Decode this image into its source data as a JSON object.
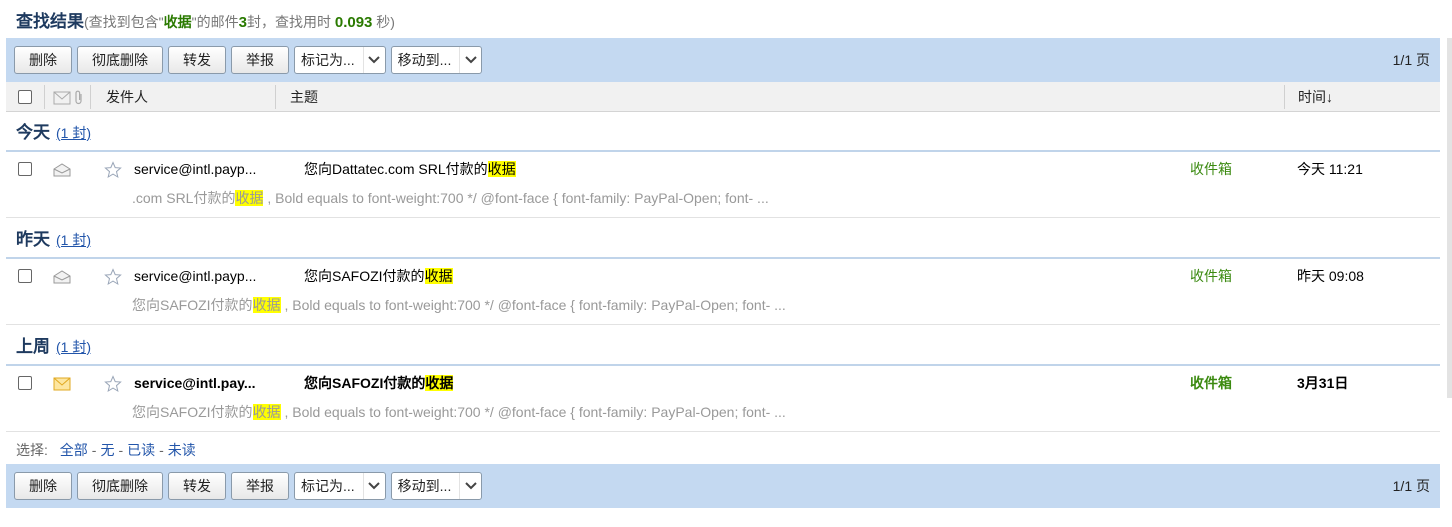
{
  "title": {
    "main": "查找结果",
    "sub_prefix": "(查找到包含\"",
    "keyword": "收据",
    "sub_mid": "\"的邮件",
    "count": "3",
    "sub_mid2": "封，查找用时 ",
    "time": "0.093",
    "sub_suffix": " 秒)"
  },
  "toolbar": {
    "delete": "删除",
    "delete_forever": "彻底删除",
    "forward": "转发",
    "report": "举报",
    "mark_as": "标记为...",
    "move_to": "移动到...",
    "pager": "1/1 页"
  },
  "columns": {
    "sender": "发件人",
    "subject": "主题",
    "time": "时间↓"
  },
  "groups": [
    {
      "name": "今天",
      "count": "(1 封)",
      "mail": {
        "sender": "service@intl.payp...",
        "subject_prefix": "您向Dattatec.com SRL付款的",
        "subject_hl": "收据",
        "folder": "收件箱",
        "time": "今天 11:21",
        "preview_prefix": ".com SRL付款的",
        "preview_hl": "收据",
        "preview_suffix": " , Bold equals to font-weight:700 */ @font-face { font-family: PayPal-Open; font- ...",
        "read": true
      }
    },
    {
      "name": "昨天",
      "count": "(1 封)",
      "mail": {
        "sender": "service@intl.payp...",
        "subject_prefix": "您向SAFOZI付款的",
        "subject_hl": "收据",
        "folder": "收件箱",
        "time": "昨天 09:08",
        "preview_prefix": "您向SAFOZI付款的",
        "preview_hl": "收据",
        "preview_suffix": " , Bold equals to font-weight:700 */ @font-face { font-family: PayPal-Open; font- ...",
        "read": true
      }
    },
    {
      "name": "上周",
      "count": "(1 封)",
      "mail": {
        "sender": "service@intl.pay...",
        "subject_prefix": "您向SAFOZI付款的",
        "subject_hl": "收据",
        "folder": "收件箱",
        "time": "3月31日",
        "preview_prefix": "您向SAFOZI付款的",
        "preview_hl": "收据",
        "preview_suffix": " , Bold equals to font-weight:700 */ @font-face { font-family: PayPal-Open; font- ...",
        "read": false
      }
    }
  ],
  "selection": {
    "label": "选择:",
    "all": "全部",
    "none": "无",
    "read": "已读",
    "unread": "未读"
  },
  "colors": {
    "toolbar_bg": "#c4d9f1",
    "folder_green": "#3b8a10",
    "highlight": "#ffff00",
    "link_blue": "#2255aa"
  }
}
